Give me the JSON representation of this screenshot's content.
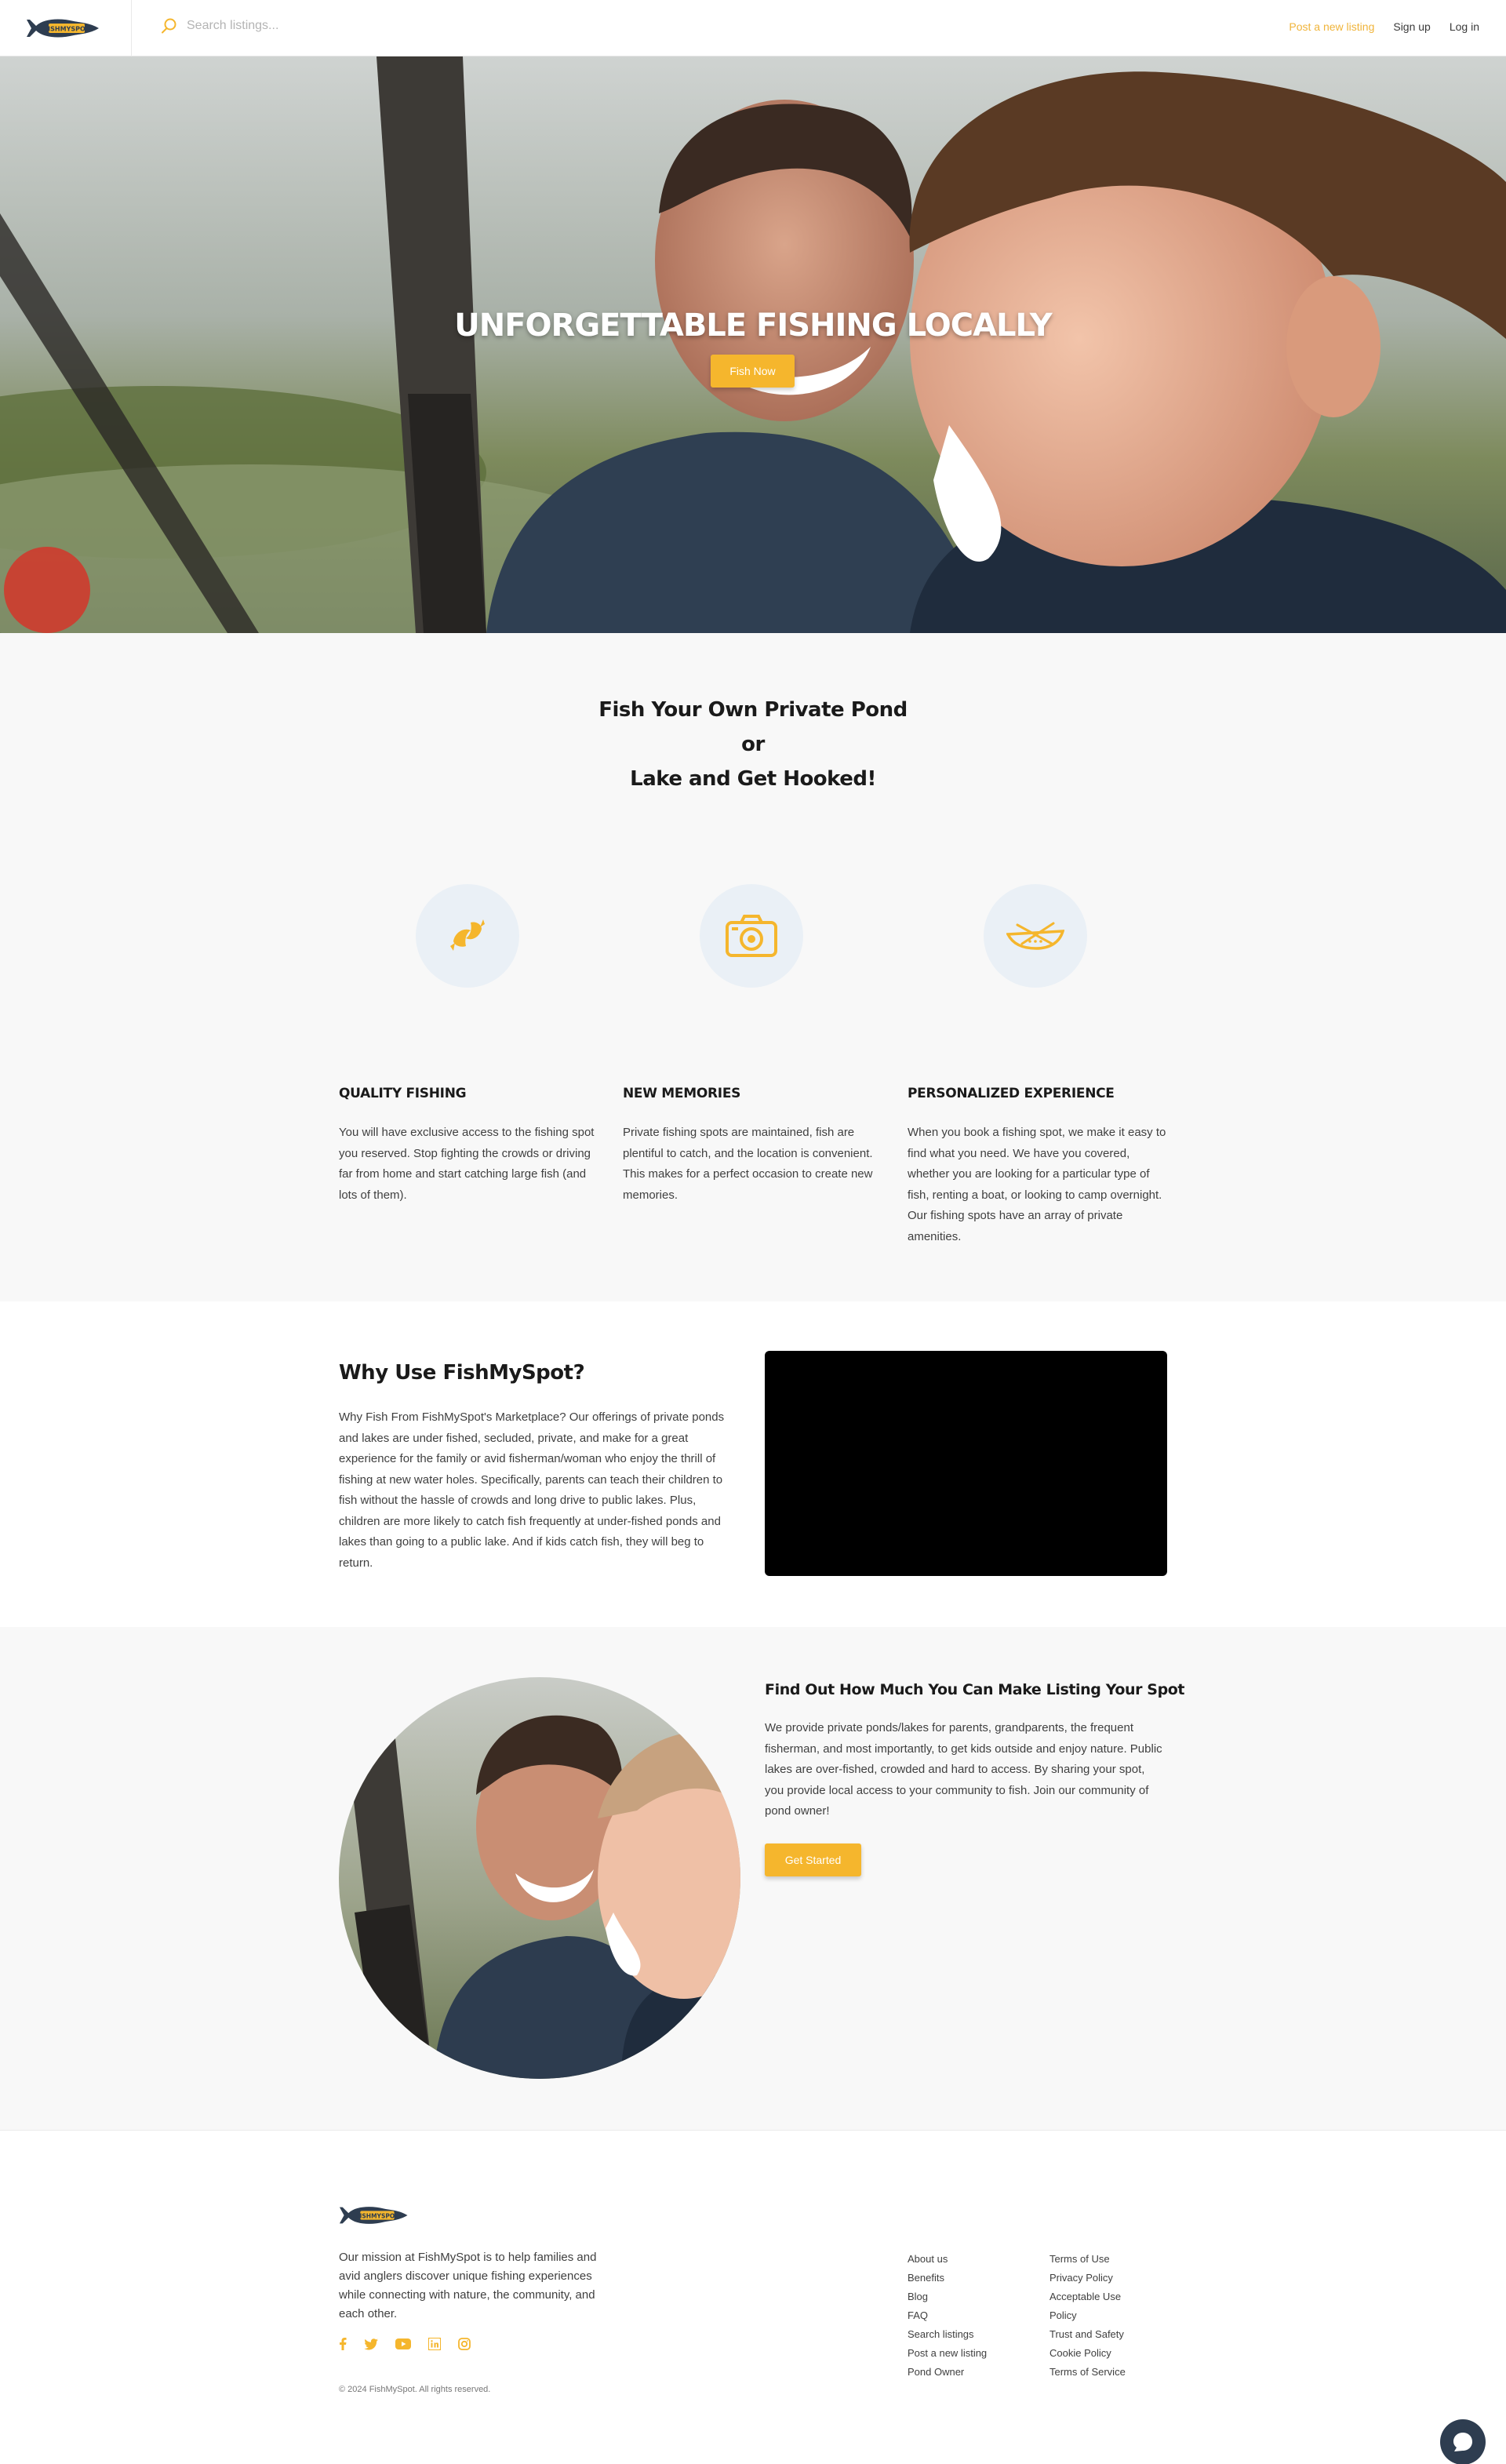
{
  "header": {
    "logo_text": "FISHMYSPOT",
    "search_placeholder": "Search listings...",
    "nav": {
      "post": "Post a new listing",
      "signup": "Sign up",
      "login": "Log in"
    }
  },
  "hero": {
    "title": "Unforgettable Fishing Locally",
    "button": "Fish Now"
  },
  "intro": {
    "title_line1": "Fish Your Own Private Pond or",
    "title_line2": "Lake and Get Hooked!",
    "features": [
      {
        "icon": "fish-icon",
        "title": "Quality Fishing",
        "text": "You will have exclusive access to the fishing spot you reserved. Stop fighting the crowds or driving far from home and start catching large fish (and lots of them)."
      },
      {
        "icon": "camera-icon",
        "title": "New Memories",
        "text": "Private fishing spots are maintained, fish are plentiful to catch, and the location is convenient. This makes for a perfect occasion to create new memories."
      },
      {
        "icon": "boat-icon",
        "title": "Personalized Experience",
        "text": "When you book a fishing spot, we make it easy to find what you need. We have you covered, whether you are looking for a particular type of fish, renting a boat, or looking to camp overnight. Our fishing spots have an array of private amenities."
      }
    ]
  },
  "why": {
    "title": "Why Use FishMySpot?",
    "text": "Why Fish From FishMySpot's Marketplace? Our offerings of private ponds and lakes are under fished, secluded, private, and make for a great experience for the family or avid fisherman/woman who enjoy the thrill of fishing at new water holes. Specifically, parents can teach their children to fish without the hassle of crowds and long drive to public lakes. Plus, children are more likely to catch fish frequently at under-fished ponds and lakes than going to a public lake. And if kids catch fish, they will beg to return."
  },
  "listing": {
    "title": "Find Out How Much You Can Make Listing Your Spot",
    "text": "We provide private ponds/lakes for parents, grandparents, the frequent fisherman, and most importantly, to get kids outside and enjoy nature. Public lakes are over-fished, crowded and hard to access. By sharing your spot, you provide local access to your community to fish. Join our community of pond owner!",
    "button": "Get Started"
  },
  "footer": {
    "mission": "Our mission at FishMySpot is to help families and avid anglers discover unique fishing experiences while connecting with nature, the community, and each other.",
    "socials": [
      "facebook-icon",
      "twitter-icon",
      "youtube-icon",
      "linkedin-icon",
      "instagram-icon"
    ],
    "copyright": "© 2024 FishMySpot. All rights reserved.",
    "col1": [
      "About us",
      "Benefits",
      "Blog",
      "FAQ",
      "Search listings",
      "Post a new listing",
      "Pond Owner"
    ],
    "col2": [
      "Terms of Use",
      "Privacy Policy",
      "Acceptable Use",
      "Policy",
      "Trust and Safety",
      "Cookie Policy",
      "Terms of Service"
    ]
  },
  "colors": {
    "accent": "#f5b62d",
    "navy": "#2e3d50",
    "icon_bg": "#eaf0f6"
  }
}
